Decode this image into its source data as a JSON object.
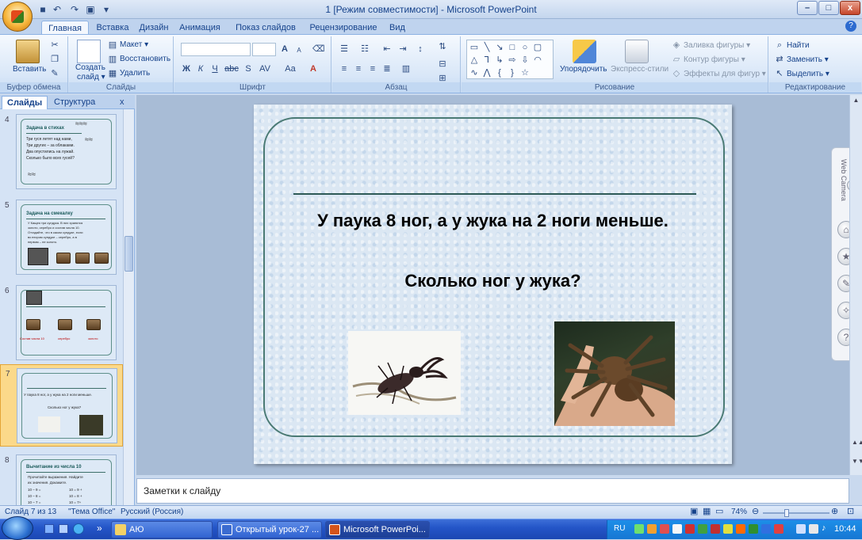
{
  "window": {
    "title": "1 [Режим совместимости] - Microsoft PowerPoint",
    "min": "–",
    "max": "□",
    "close": "x"
  },
  "tabs": [
    "Главная",
    "Вставка",
    "Дизайн",
    "Анимация",
    "Показ слайдов",
    "Рецензирование",
    "Вид"
  ],
  "ribbon": {
    "clipboard": {
      "paste": "Вставить",
      "label": "Буфер обмена"
    },
    "slides": {
      "create": "Создать",
      "create2": "слайд ▾",
      "layout": "Макет ▾",
      "reset": "Восстановить",
      "delete": "Удалить",
      "label": "Слайды"
    },
    "font": {
      "label": "Шрифт",
      "bold": "Ж",
      "italic": "К",
      "underline": "Ч",
      "strike": "abc",
      "shadow": "S",
      "spacing": "AV",
      "case": "Aa",
      "grow": "A",
      "shrink": "A"
    },
    "paragraph": {
      "label": "Абзац"
    },
    "drawing": {
      "arrange": "Упорядочить",
      "quick_styles": "Экспресс-стили",
      "fill": "Заливка фигуры ▾",
      "outline": "Контур фигуры ▾",
      "effects": "Эффекты для фигур ▾",
      "label": "Рисование"
    },
    "editing": {
      "find": "Найти",
      "replace": "Заменить ▾",
      "select": "Выделить ▾",
      "label": "Редактирование"
    }
  },
  "left_pane": {
    "tab_slides": "Слайды",
    "tab_outline": "Структура",
    "close": "x",
    "thumbs": [
      {
        "num": "4",
        "title": "Задача в стихах",
        "lines": [
          "Три гуся летят над нами,",
          "Три других – за облаками.",
          "Два опустились на лужай.",
          "Сколько было всех гусей?"
        ]
      },
      {
        "num": "5",
        "title": "Задача на смекалку",
        "lines": [
          "У Кащея три сундука. В них хранятся",
          "золото, серебро и состав числа 10.",
          "Отгадайте, что в каком сундуке, если",
          "во втором сундуке – серебро, а в",
          "первом – не золото."
        ]
      },
      {
        "num": "6",
        "labels": [
          "Состав числа 10",
          "серебро",
          "золото"
        ]
      },
      {
        "num": "7",
        "lines": [
          "У паука 8 ног, а у жука на 2 ноги меньше.",
          "Сколько ног у жука?"
        ]
      },
      {
        "num": "8",
        "title": "Вычитание из числа 10",
        "lines": [
          "Прочитайте выражения. Найдите",
          "их значения. Докажите."
        ],
        "exprs": [
          "10 – 9 =",
          "10 = 9 +",
          "10 – 8 =",
          "10 = 8 +",
          "10 – 7 =",
          "10 = 7+"
        ]
      }
    ]
  },
  "slide": {
    "line1": "У паука 8 ног, а у жука на 2 ноги меньше.",
    "line2": "Сколько ног у жука?"
  },
  "dock": {
    "label": "Web Camera"
  },
  "notes": {
    "placeholder": "Заметки к слайду"
  },
  "status": {
    "slide": "Слайд 7 из 13",
    "theme": "\"Тема Office\"",
    "lang": "Русский (Россия)",
    "zoom": "74%",
    "zoom_level": 0.74
  },
  "taskbar": {
    "items": [
      "АЮ",
      "Открытый урок-27 ...",
      "Microsoft PowerPoi..."
    ],
    "lang": "RU",
    "time": "10:44",
    "chevron": "»"
  }
}
